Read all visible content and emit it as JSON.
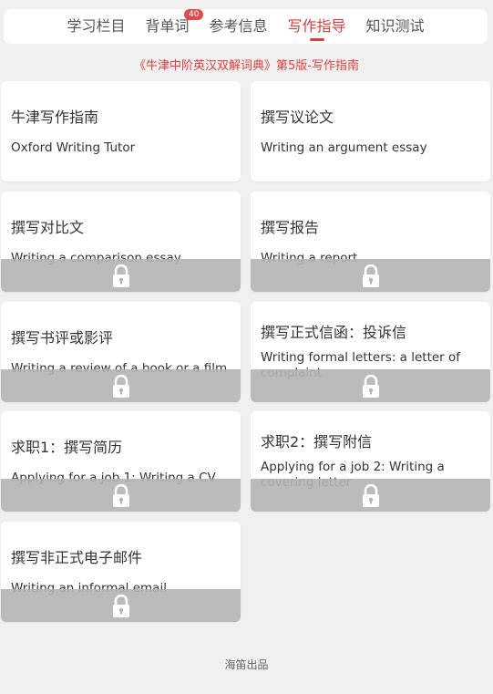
{
  "tabs": [
    {
      "label": "学习栏目"
    },
    {
      "label": "背单词",
      "badge": "40"
    },
    {
      "label": "参考信息"
    },
    {
      "label": "写作指导",
      "active": true
    },
    {
      "label": "知识测试"
    }
  ],
  "subtitle": "《牛津中阶英汉双解词典》第5版-写作指南",
  "cards": [
    {
      "zh": "牛津写作指南",
      "en": "Oxford Writing Tutor",
      "locked": false
    },
    {
      "zh": "撰写议论文",
      "en": "Writing an argument essay",
      "locked": false
    },
    {
      "zh": "撰写对比文",
      "en": "Writing a comparison essay",
      "locked": true
    },
    {
      "zh": "撰写报告",
      "en": "Writing a report",
      "locked": true
    },
    {
      "zh": "撰写书评或影评",
      "en": "Writing a review of a book or a film",
      "locked": true
    },
    {
      "zh": "撰写正式信函：投诉信",
      "en": "Writing formal letters: a letter of complaint",
      "locked": true
    },
    {
      "zh": "求职1：撰写简历",
      "en": "Applying for a job 1: Writing a CV",
      "locked": true
    },
    {
      "zh": "求职2：撰写附信",
      "en": "Applying for a job 2: Writing a covering letter",
      "locked": true
    },
    {
      "zh": "撰写非正式电子邮件",
      "en": "Writing an informal email",
      "locked": true
    }
  ],
  "footer": "海笛出品",
  "colors": {
    "accent": "#e03c3c",
    "badge": "#e04b4b",
    "lock_overlay": "#b4b4b4"
  },
  "icons": {
    "lock": "lock-icon"
  }
}
